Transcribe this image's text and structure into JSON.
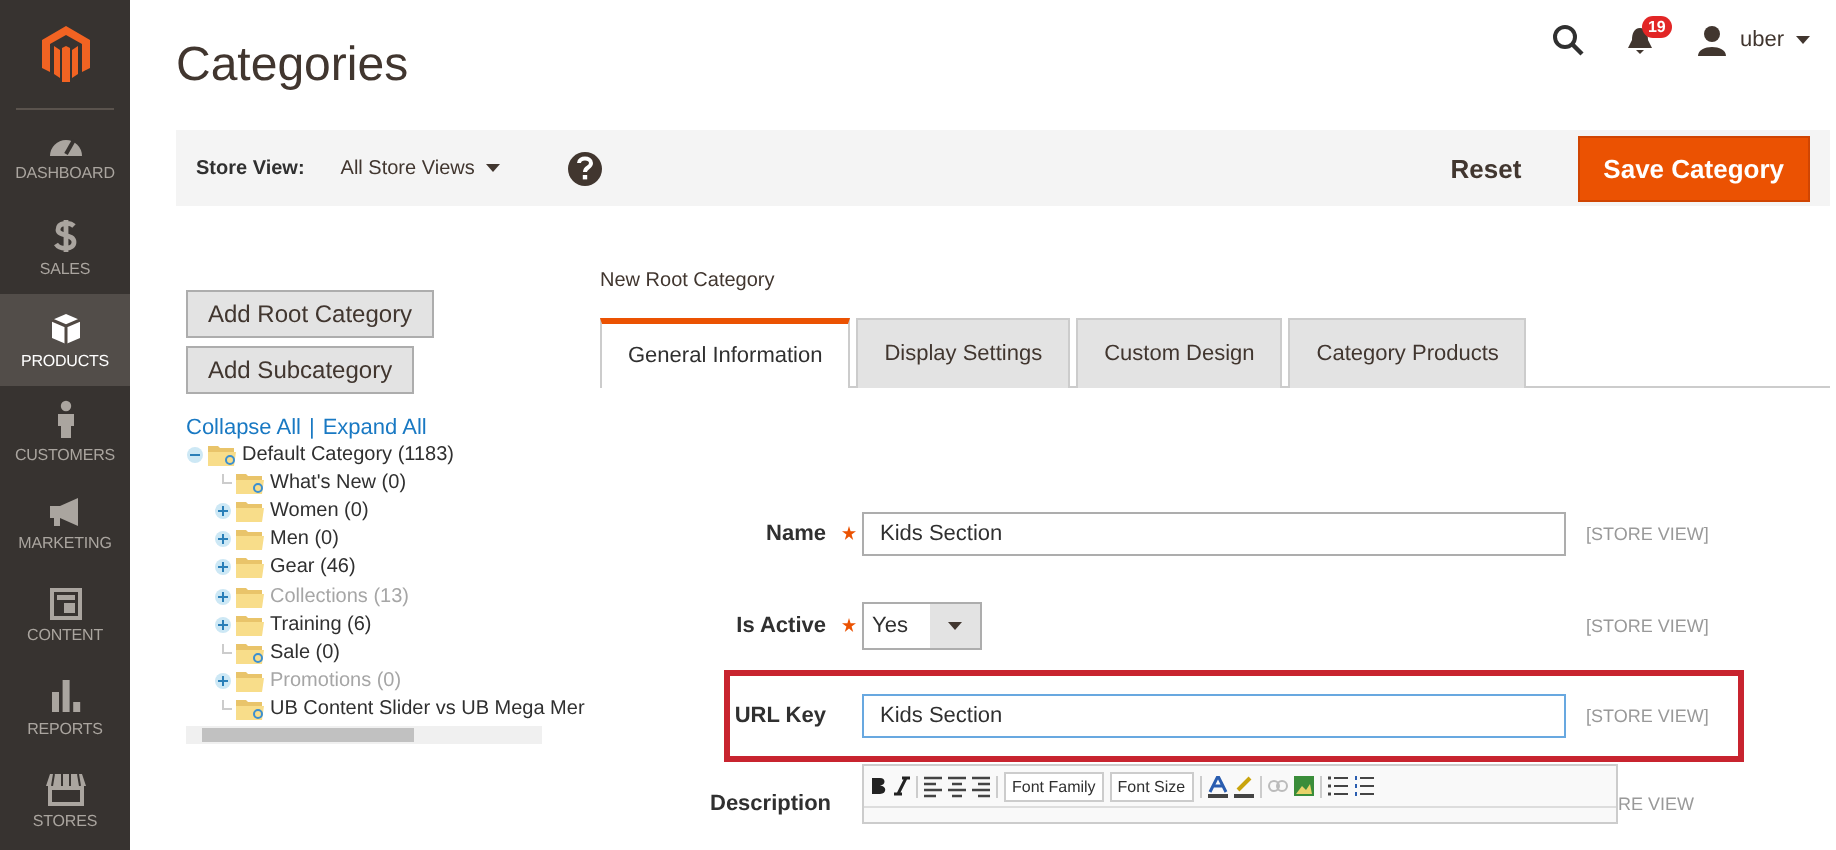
{
  "sidebar": {
    "items": [
      {
        "label": "DASHBOARD",
        "selected": false
      },
      {
        "label": "SALES",
        "selected": false
      },
      {
        "label": "PRODUCTS",
        "selected": true
      },
      {
        "label": "CUSTOMERS",
        "selected": false
      },
      {
        "label": "MARKETING",
        "selected": false
      },
      {
        "label": "CONTENT",
        "selected": false
      },
      {
        "label": "REPORTS",
        "selected": false
      },
      {
        "label": "STORES",
        "selected": false
      }
    ]
  },
  "header": {
    "title": "Categories",
    "notifications": "19",
    "user": "uber"
  },
  "toolbar": {
    "store_view_label": "Store View:",
    "store_view": "All Store Views",
    "reset": "Reset",
    "save": "Save Category"
  },
  "left": {
    "buttons": [
      "Add Root Category",
      "Add Subcategory"
    ],
    "collapse_all": "Collapse All",
    "separator": "|",
    "expand_all": "Expand All",
    "tree": [
      {
        "label": "Default Category (1183)",
        "kind": "expanded",
        "enabled": true,
        "children": [
          {
            "label": "What's New (0)",
            "kind": "leaf",
            "enabled": true
          },
          {
            "label": "Women (0)",
            "kind": "collapsed",
            "enabled": true
          },
          {
            "label": "Men (0)",
            "kind": "collapsed",
            "enabled": true
          },
          {
            "label": "Gear (46)",
            "kind": "collapsed",
            "enabled": true
          },
          {
            "label": "Collections (13)",
            "kind": "collapsed",
            "enabled": false
          },
          {
            "label": "Training (6)",
            "kind": "collapsed",
            "enabled": true
          },
          {
            "label": "Sale (0)",
            "kind": "leaf",
            "enabled": true
          },
          {
            "label": "Promotions (0)",
            "kind": "collapsed",
            "enabled": false
          },
          {
            "label": "UB Content Slider vs UB Mega Mer",
            "kind": "leaf",
            "enabled": true
          }
        ]
      }
    ]
  },
  "form": {
    "heading": "New Root Category",
    "tabs": [
      {
        "label": "General Information",
        "selected": true
      },
      {
        "label": "Display Settings",
        "selected": false
      },
      {
        "label": "Custom Design",
        "selected": false
      },
      {
        "label": "Category Products",
        "selected": false
      }
    ],
    "fields": [
      {
        "label": "Name",
        "required": true,
        "kind": "text",
        "value": "Kids Section",
        "scope": "[STORE VIEW]",
        "highlighted": false
      },
      {
        "label": "Is Active",
        "required": true,
        "kind": "select",
        "value": "Yes",
        "scope": "[STORE VIEW]",
        "highlighted": false
      },
      {
        "label": "URL Key",
        "required": false,
        "kind": "text",
        "value": "Kids Section",
        "scope": "[STORE VIEW]",
        "highlighted": true
      },
      {
        "label": "Description",
        "required": false,
        "kind": "editor",
        "font_family": "Font Family",
        "font_size": "Font Size",
        "scope": "RE VIEW",
        "highlighted": false
      }
    ]
  }
}
